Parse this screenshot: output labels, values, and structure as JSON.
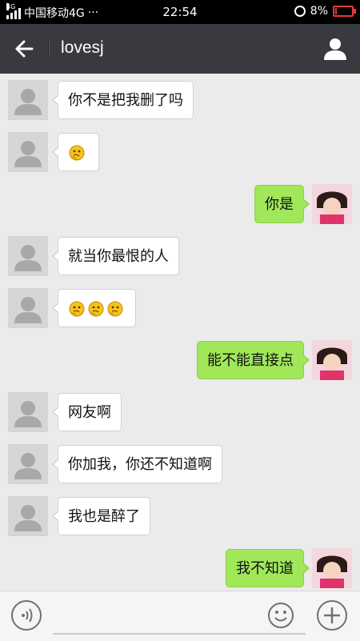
{
  "status_bar": {
    "network_tag": "4G",
    "carrier": "中国移动4G",
    "overflow": "···",
    "time": "22:54",
    "battery_text": "8%",
    "battery_level": 0.08
  },
  "header": {
    "title": "lovesj",
    "back_icon": "arrow-left-icon",
    "profile_icon": "person-icon"
  },
  "messages": [
    {
      "side": "left",
      "text": "你不是把我删了吗"
    },
    {
      "side": "left",
      "text": "",
      "emoji_count": 1
    },
    {
      "side": "right",
      "text": "你是"
    },
    {
      "side": "left",
      "text": "就当你最恨的人"
    },
    {
      "side": "left",
      "text": "",
      "emoji_count": 3
    },
    {
      "side": "right",
      "text": "能不能直接点"
    },
    {
      "side": "left",
      "text": "网友啊"
    },
    {
      "side": "left",
      "text": "你加我，你还不知道啊"
    },
    {
      "side": "left",
      "text": "我也是醉了"
    },
    {
      "side": "right",
      "text": "我不知道"
    }
  ],
  "input_bar": {
    "placeholder": "",
    "voice_icon": "voice-icon",
    "emoji_icon": "smiley-icon",
    "plus_icon": "plus-icon"
  },
  "colors": {
    "header_bg": "#393a3f",
    "chat_bg": "#ebebeb",
    "bubble_in": "#ffffff",
    "bubble_out": "#a0e75a",
    "battery": "#e53935"
  }
}
